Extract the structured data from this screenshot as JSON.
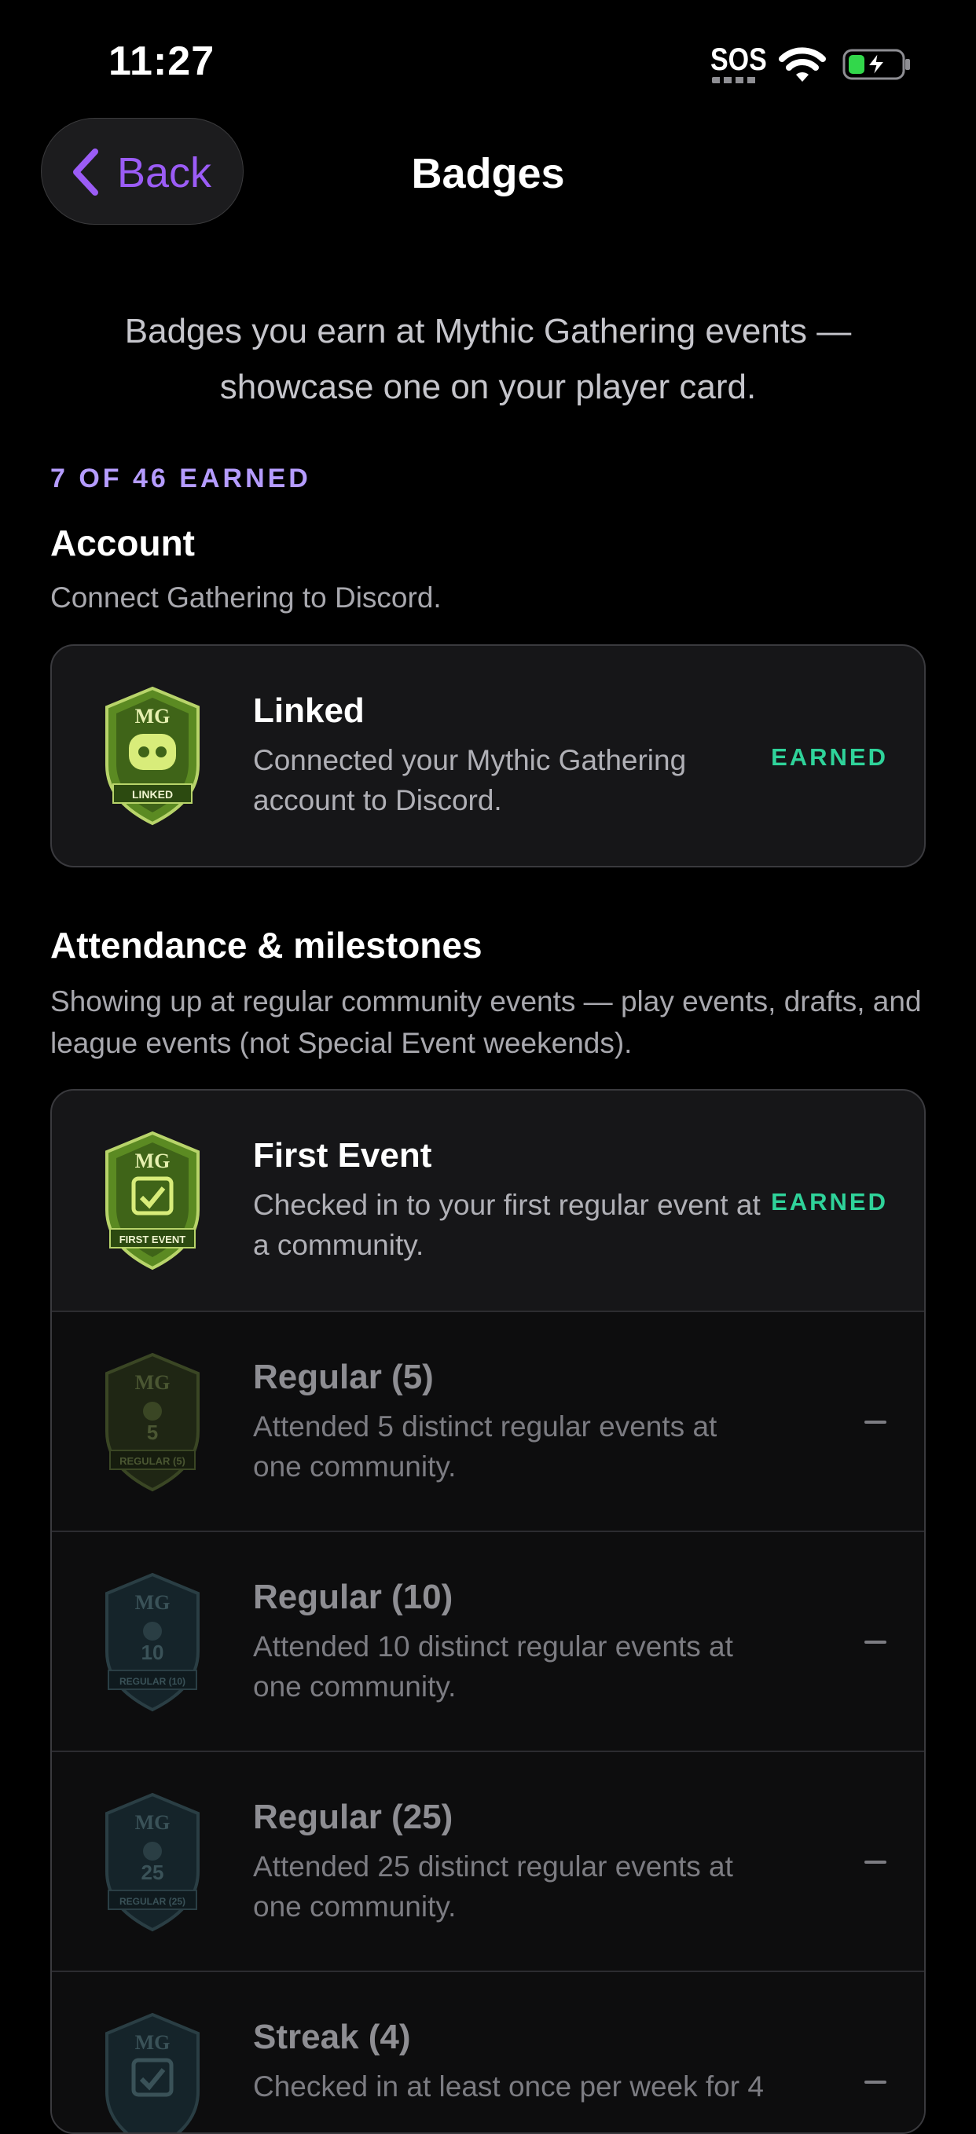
{
  "status_bar": {
    "time": "11:27",
    "carrier": "SOS"
  },
  "nav": {
    "back_label": "Back",
    "title": "Badges"
  },
  "intro": "Badges you earn at Mythic Gathering events — showcase one on your player card.",
  "earned_summary": "7 OF 46 EARNED",
  "sections": [
    {
      "title": "Account",
      "description": "Connect Gathering to Discord.",
      "badges": [
        {
          "title": "Linked",
          "description": "Connected your Mythic Gathering account to Discord.",
          "status": "EARNED",
          "badge_text": "LINKED",
          "badge_logo": "MG"
        }
      ]
    },
    {
      "title": "Attendance & milestones",
      "description": "Showing up at regular community events — play events, drafts, and league events (not Special Event weekends).",
      "badges": [
        {
          "title": "First Event",
          "description": "Checked in to your first regular event at a community.",
          "status": "EARNED",
          "badge_text": "FIRST EVENT",
          "badge_logo": "MG"
        },
        {
          "title": "Regular (5)",
          "description": "Attended 5 distinct regular events at one community.",
          "status": "—",
          "badge_text": "REGULAR (5)",
          "badge_number": "5",
          "badge_logo": "MG"
        },
        {
          "title": "Regular (10)",
          "description": "Attended 10 distinct regular events at one community.",
          "status": "—",
          "badge_text": "REGULAR (10)",
          "badge_number": "10",
          "badge_logo": "MG"
        },
        {
          "title": "Regular (25)",
          "description": "Attended 25 distinct regular events at one community.",
          "status": "—",
          "badge_text": "REGULAR (25)",
          "badge_number": "25",
          "badge_logo": "MG"
        },
        {
          "title": "Streak (4)",
          "description": "Checked in at least once per week for 4",
          "status": "—",
          "badge_logo": "MG"
        }
      ]
    }
  ],
  "colors": {
    "accent": "#9b5cf6",
    "earned": "#2fd39a",
    "summary": "#b59cff",
    "badge_green": "#6a9a2a",
    "badge_locked_olive": "#2f3a1e",
    "badge_locked_teal": "#1e3234"
  }
}
